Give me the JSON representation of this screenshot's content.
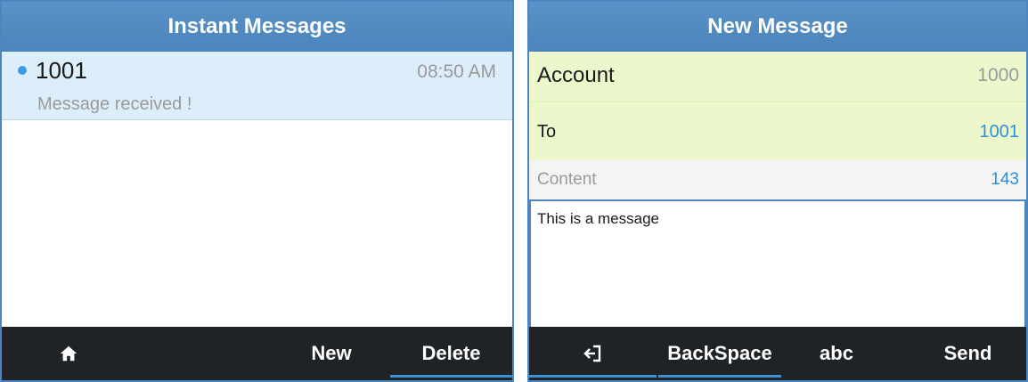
{
  "left_screen": {
    "title": "Instant Messages",
    "messages": [
      {
        "sender": "1001",
        "time": "08:50 AM",
        "preview": "Message received !",
        "unread": true
      }
    ],
    "softkeys": {
      "home_icon": "home-icon",
      "new_label": "New",
      "delete_label": "Delete"
    }
  },
  "right_screen": {
    "title": "New Message",
    "account_label": "Account",
    "account_value": "1000",
    "to_label": "To",
    "to_value": "1001",
    "content_label": "Content",
    "content_count": "143",
    "message_text": "This is a message",
    "softkeys": {
      "back_icon": "exit-icon",
      "backspace_label": "BackSpace",
      "abc_label": "abc",
      "send_label": "Send"
    }
  },
  "colors": {
    "title_bar": "#4d86be",
    "selected_row": "#ddeefb",
    "field_highlight": "#ecf8cc",
    "accent_blue": "#2e8fdd",
    "softkey_bar": "#1f2326"
  }
}
